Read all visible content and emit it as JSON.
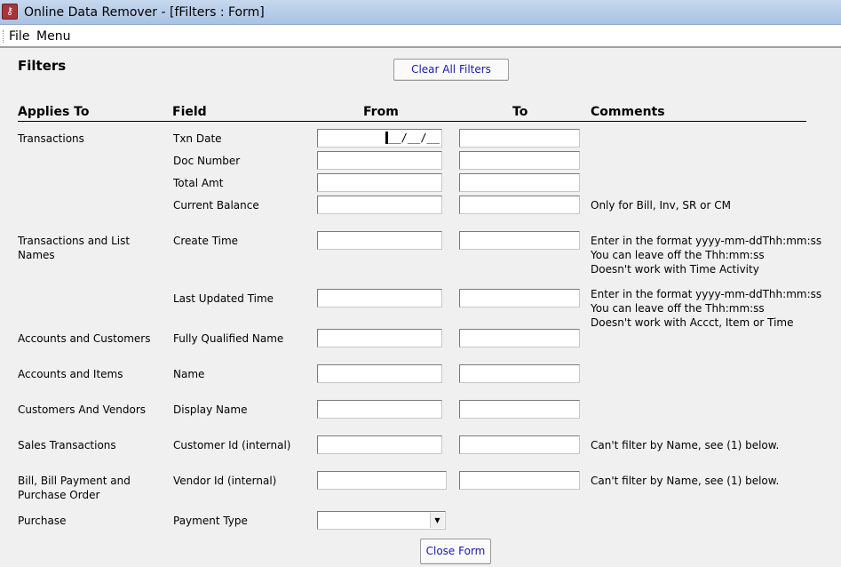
{
  "window": {
    "title": "Online Data Remover - [fFilters : Form]"
  },
  "menu": {
    "items": [
      "File",
      "Menu"
    ]
  },
  "form": {
    "heading": "Filters",
    "clear_button": "Clear All Filters",
    "close_button": "Close Form",
    "columns": {
      "applies_to": "Applies To",
      "field": "Field",
      "from": "From",
      "to": "To",
      "comments": "Comments"
    },
    "rows": [
      {
        "applies_to": [
          "Transactions"
        ],
        "field": "Txn Date",
        "from_value": "__/__/__",
        "to_value": "",
        "comments": []
      },
      {
        "applies_to": [],
        "field": "Doc Number",
        "from_value": "",
        "to_value": "",
        "comments": []
      },
      {
        "applies_to": [],
        "field": "Total Amt",
        "from_value": "",
        "to_value": "",
        "comments": []
      },
      {
        "applies_to": [],
        "field": "Current Balance",
        "from_value": "",
        "to_value": "",
        "comments": [
          "Only for Bill, Inv, SR or CM"
        ]
      },
      {
        "applies_to": [
          "Transactions and List",
          "Names"
        ],
        "field": "Create Time",
        "from_value": "",
        "to_value": "",
        "comments": [
          "Enter in the format yyyy-mm-ddThh:mm:ss",
          "You can leave off the Thh:mm:ss",
          "Doesn't work with Time Activity"
        ]
      },
      {
        "applies_to": [],
        "field": "Last Updated Time",
        "from_value": "",
        "to_value": "",
        "comments": [
          "Enter in the format yyyy-mm-ddThh:mm:ss",
          "You can leave off the Thh:mm:ss",
          "Doesn't work with Accct, Item or Time"
        ]
      },
      {
        "applies_to": [
          "Accounts and Customers"
        ],
        "field": "Fully Qualified Name",
        "from_value": "",
        "to_value": "",
        "comments": []
      },
      {
        "applies_to": [
          "Accounts and Items"
        ],
        "field": "Name",
        "from_value": "",
        "to_value": "",
        "comments": []
      },
      {
        "applies_to": [
          "Customers And Vendors"
        ],
        "field": "Display Name",
        "from_value": "",
        "to_value": "",
        "comments": []
      },
      {
        "applies_to": [
          "Sales Transactions"
        ],
        "field": "Customer Id (internal)",
        "from_value": "",
        "to_value": "",
        "comments": [
          "Can't filter by Name, see (1) below."
        ]
      },
      {
        "applies_to": [
          "Bill, Bill Payment and",
          "Purchase Order"
        ],
        "field": "Vendor Id (internal)",
        "from_value": "",
        "to_value": "",
        "comments": [
          "Can't filter by Name, see (1) below."
        ]
      },
      {
        "applies_to": [
          "Purchase"
        ],
        "field": "Payment Type",
        "from_value": "",
        "comments": []
      }
    ]
  },
  "icons": {
    "app": "access-key-icon",
    "dropdown": "chevron-down-icon"
  },
  "colors": {
    "title_bar": "#aac2e3",
    "button_text": "#1a1aa8",
    "app_icon": "#a4373a"
  }
}
